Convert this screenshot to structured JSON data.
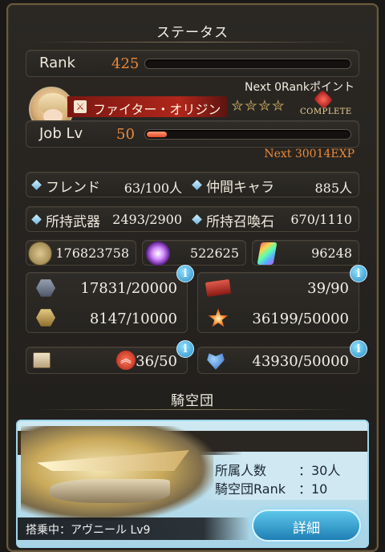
{
  "status": {
    "title": "ステータス",
    "rank_label": "Rank",
    "rank_value": "425",
    "rank_progress": 0.0,
    "next_rank": "Next 0Rankポイント",
    "job_name": "ファイター・オリジン",
    "complete_label": "COMPLETE",
    "joblv_label": "Job Lv",
    "joblv_value": "50",
    "joblv_progress": 0.1,
    "next_exp": "Next 30014EXP",
    "friend_label": "フレンド",
    "friend_value": "63/100人",
    "ally_label": "仲間キャラ",
    "ally_value": "885人",
    "weapons_label": "所持武器",
    "weapons_value": "2493/2900",
    "summons_label": "所持召喚石",
    "summons_value": "670/1110",
    "rupie": "176823758",
    "crystal": "522625",
    "prism": "96248",
    "stat1": "17831/20000",
    "stat2": "39/90",
    "stat3": "8147/10000",
    "stat4": "36199/50000",
    "stat5": "36/50",
    "stat6": "43930/50000"
  },
  "crew": {
    "title": "騎空団",
    "members_label": "所属人数",
    "members_value": "：30人",
    "rank_label": "騎空団Rank",
    "rank_value": "：10",
    "airship": "搭乗中：アヴニール Lv9",
    "detail_button": "詳細"
  },
  "colors": {
    "accent_orange": "#e98a3b",
    "info_blue": "#2b8fc8",
    "bar_red": "#e24a2a"
  }
}
